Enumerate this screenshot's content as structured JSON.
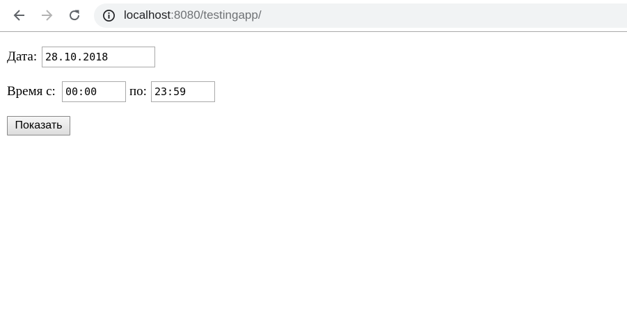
{
  "browser": {
    "url_host": "localhost",
    "url_rest": ":8080/testingapp/",
    "icons": {
      "back": "back-arrow-icon",
      "forward": "forward-arrow-icon",
      "reload": "reload-icon",
      "info": "info-icon"
    }
  },
  "form": {
    "date_label": "Дата:",
    "date_value": "28.10.2018",
    "time_from_label": "Время с:",
    "time_from_value": "00:00",
    "time_to_label": "по:",
    "time_to_value": "23:59",
    "submit_label": "Показать"
  }
}
